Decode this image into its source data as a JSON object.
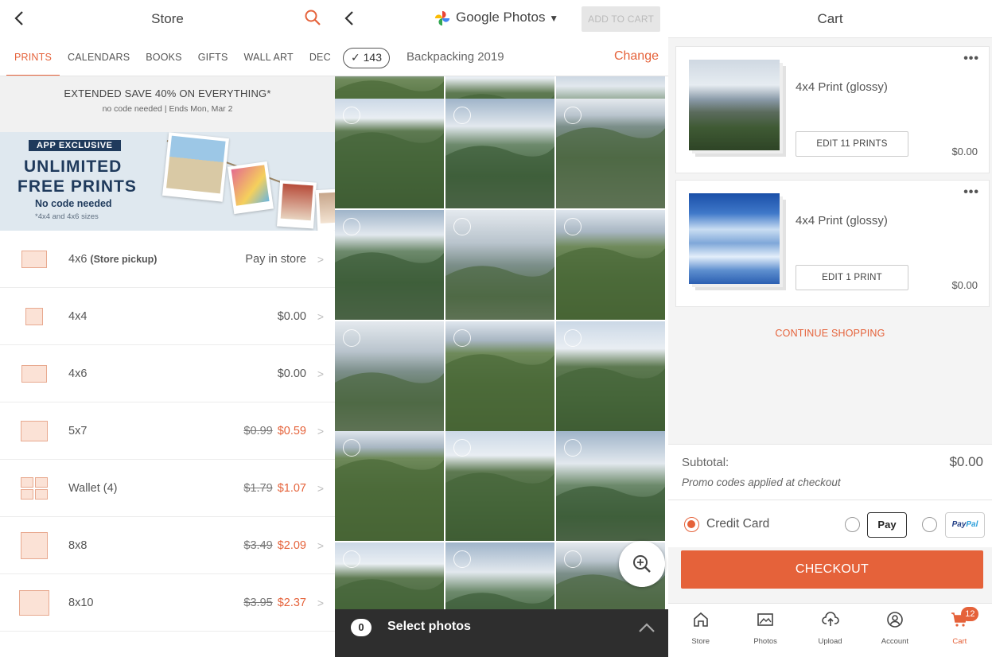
{
  "store": {
    "title": "Store",
    "tabs": [
      "PRINTS",
      "CALENDARS",
      "BOOKS",
      "GIFTS",
      "WALL ART",
      "DEC"
    ],
    "promo_line1": "EXTENDED SAVE 40% ON EVERYTHING*",
    "promo_line2": "no code needed | Ends Mon, Mar 2",
    "banner": {
      "tag": "APP EXCLUSIVE",
      "line1": "UNLIMITED",
      "line2": "FREE PRINTS",
      "line3": "No code needed",
      "line4": "*4x4 and 4x6 sizes"
    },
    "rows": [
      {
        "name": "4x6",
        "note": "(Store pickup)",
        "orig": "",
        "price": "Pay in store"
      },
      {
        "name": "4x4",
        "note": "",
        "orig": "",
        "price": "$0.00"
      },
      {
        "name": "4x6",
        "note": "",
        "orig": "",
        "price": "$0.00"
      },
      {
        "name": "5x7",
        "note": "",
        "orig": "$0.99",
        "price": "$0.59"
      },
      {
        "name": "Wallet (4)",
        "note": "",
        "orig": "$1.79",
        "price": "$1.07"
      },
      {
        "name": "8x8",
        "note": "",
        "orig": "$3.49",
        "price": "$2.09"
      },
      {
        "name": "8x10",
        "note": "",
        "orig": "$3.95",
        "price": "$2.37"
      }
    ]
  },
  "photos": {
    "source": "Google Photos",
    "add_to_cart": "ADD TO CART",
    "count": "143",
    "album": "Backpacking 2019",
    "change": "Change",
    "select_count": "0",
    "select_label": "Select photos"
  },
  "cart": {
    "title": "Cart",
    "items": [
      {
        "title": "4x4 Print (glossy)",
        "edit": "EDIT 11 PRINTS",
        "price": "$0.00"
      },
      {
        "title": "4x4 Print (glossy)",
        "edit": "EDIT 1 PRINT",
        "price": "$0.00"
      }
    ],
    "continue": "CONTINUE SHOPPING",
    "subtotal_label": "Subtotal:",
    "subtotal_value": "$0.00",
    "promo_note": "Promo codes applied at checkout",
    "payment": {
      "credit": "Credit Card",
      "apple": "Pay",
      "paypal_a": "Pay",
      "paypal_b": "Pal"
    },
    "checkout": "CHECKOUT",
    "tabbar": [
      {
        "label": "Store",
        "icon": "home-icon"
      },
      {
        "label": "Photos",
        "icon": "photos-icon"
      },
      {
        "label": "Upload",
        "icon": "upload-icon"
      },
      {
        "label": "Account",
        "icon": "account-icon"
      },
      {
        "label": "Cart",
        "icon": "cart-icon"
      }
    ],
    "cart_badge": "12"
  },
  "colors": {
    "accent": "#e5623a",
    "navy": "#1f3a5c"
  }
}
